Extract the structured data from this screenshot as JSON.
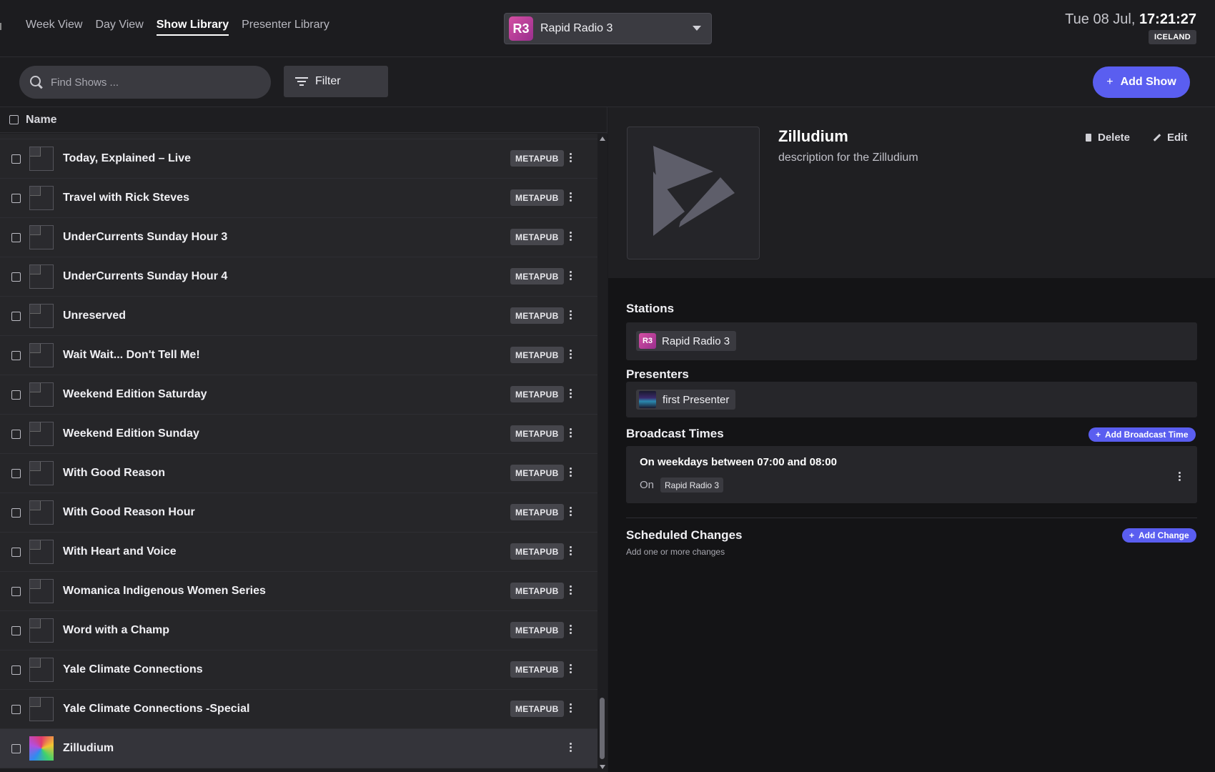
{
  "nav": {
    "tabs": [
      "Week View",
      "Day View",
      "Show Library",
      "Presenter Library"
    ],
    "active_tab": "Show Library"
  },
  "station_select": {
    "badge": "R3",
    "name": "Rapid Radio 3"
  },
  "clock": {
    "date": "Tue 08 Jul,",
    "time": "17:21:27",
    "timezone": "ICELAND"
  },
  "toolbar": {
    "search_placeholder": "Find Shows ...",
    "filter_label": "Filter",
    "add_show_label": "Add Show"
  },
  "list": {
    "header": "Name",
    "rows": [
      {
        "name": "Today, Explained – Live",
        "tag": "METAPUB"
      },
      {
        "name": "Travel with Rick Steves",
        "tag": "METAPUB"
      },
      {
        "name": "UnderCurrents Sunday Hour 3",
        "tag": "METAPUB"
      },
      {
        "name": "UnderCurrents Sunday Hour 4",
        "tag": "METAPUB"
      },
      {
        "name": "Unreserved",
        "tag": "METAPUB"
      },
      {
        "name": "Wait Wait... Don't Tell Me!",
        "tag": "METAPUB"
      },
      {
        "name": "Weekend Edition Saturday",
        "tag": "METAPUB"
      },
      {
        "name": "Weekend Edition Sunday",
        "tag": "METAPUB"
      },
      {
        "name": "With Good Reason",
        "tag": "METAPUB"
      },
      {
        "name": "With Good Reason Hour",
        "tag": "METAPUB"
      },
      {
        "name": "With Heart and Voice",
        "tag": "METAPUB"
      },
      {
        "name": "Womanica Indigenous Women Series",
        "tag": "METAPUB"
      },
      {
        "name": "Word with a Champ",
        "tag": "METAPUB"
      },
      {
        "name": "Yale Climate Connections",
        "tag": "METAPUB"
      },
      {
        "name": "Yale Climate Connections -Special",
        "tag": "METAPUB"
      },
      {
        "name": "Zilludium",
        "tag": ""
      }
    ]
  },
  "detail": {
    "title": "Zilludium",
    "description": "description for the Zilludium",
    "delete_label": "Delete",
    "edit_label": "Edit",
    "stations_title": "Stations",
    "station_chip": {
      "badge": "R3",
      "name": "Rapid Radio 3"
    },
    "presenters_title": "Presenters",
    "presenter_chip": "first Presenter",
    "broadcast_title": "Broadcast Times",
    "add_broadcast_label": "Add Broadcast Time",
    "broadcast_item": {
      "title": "On weekdays between 07:00 and 08:00",
      "on_label": "On",
      "station": "Rapid Radio 3"
    },
    "scheduled_title": "Scheduled Changes",
    "scheduled_subtitle": "Add one or more changes",
    "add_change_label": "Add Change"
  },
  "colors": {
    "accent": "#5a5ef0",
    "background": "#1b1b1e",
    "r3_badge": "#c0409a"
  }
}
